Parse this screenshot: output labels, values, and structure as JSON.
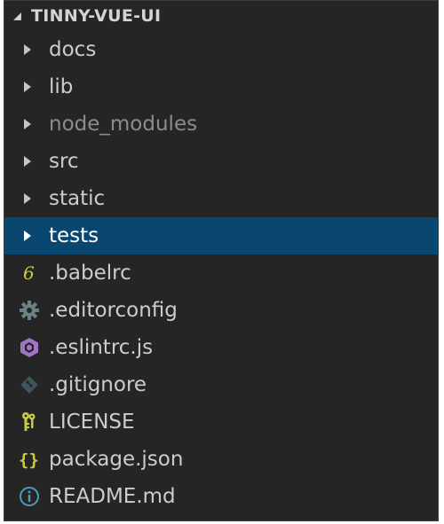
{
  "explorer": {
    "section_title": "TINNY-VUE-UI",
    "folders": [
      {
        "label": "docs"
      },
      {
        "label": "lib"
      },
      {
        "label": "node_modules"
      },
      {
        "label": "src"
      },
      {
        "label": "static"
      },
      {
        "label": "tests"
      }
    ],
    "files": [
      {
        "label": ".babelrc",
        "icon": "babel-icon",
        "icon_color": "#cbcb41"
      },
      {
        "label": ".editorconfig",
        "icon": "gear-icon",
        "icon_color": "#6d8086"
      },
      {
        "label": ".eslintrc.js",
        "icon": "eslint-icon",
        "icon_color": "#a074c4"
      },
      {
        "label": ".gitignore",
        "icon": "git-icon",
        "icon_color": "#41535b"
      },
      {
        "label": "LICENSE",
        "icon": "license-icon",
        "icon_color": "#cbcb41"
      },
      {
        "label": "package.json",
        "icon": "json-braces-icon",
        "icon_color": "#cbcb41"
      },
      {
        "label": "README.md",
        "icon": "info-icon",
        "icon_color": "#519aba"
      }
    ],
    "selected": "tests",
    "colors": {
      "background": "#252526",
      "selection": "#094771",
      "text": "#cccccc",
      "dimmed_text": "#8c8c8c"
    }
  }
}
